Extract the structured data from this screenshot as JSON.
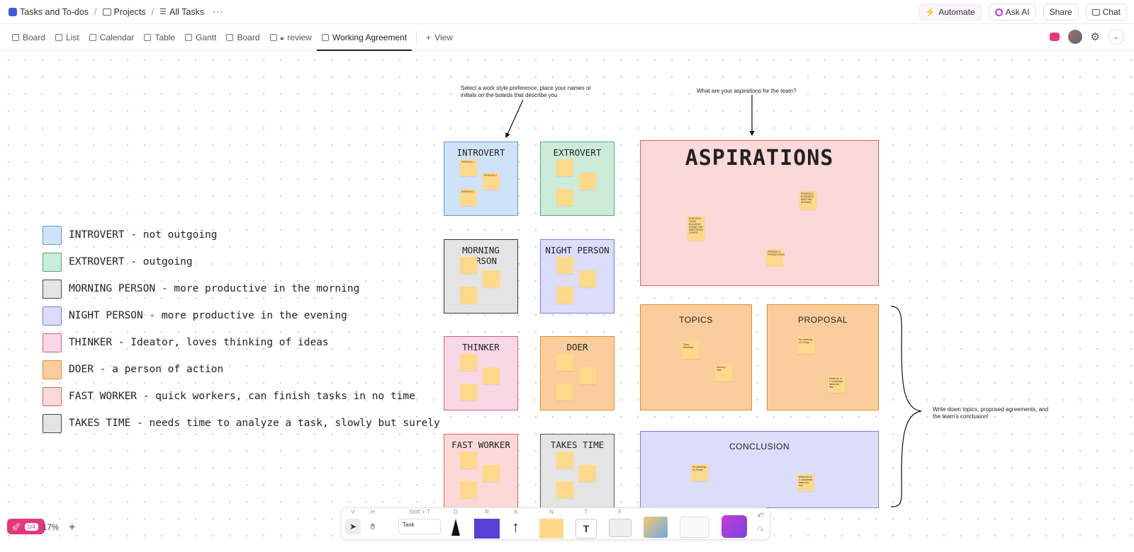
{
  "breadcrumb": {
    "workspace": "Tasks and To-dos",
    "projects": "Projects",
    "list": "All Tasks",
    "more": "···"
  },
  "top_actions": {
    "automate": "Automate",
    "ask_ai": "Ask AI",
    "share": "Share",
    "chat": "Chat"
  },
  "views": {
    "tabs": [
      "Board",
      "List",
      "Calendar",
      "Table",
      "Gantt",
      "Board",
      "review",
      "Working Agreement"
    ],
    "active": "Working Agreement",
    "add_view": "View"
  },
  "legend": [
    {
      "text": "INTROVERT - not outgoing",
      "color": "#cfe3f8"
    },
    {
      "text": "EXTROVERT - outgoing",
      "color": "#cdebd9"
    },
    {
      "text": "MORNING PERSON - more productive in the morning",
      "color": "#e4e4e4"
    },
    {
      "text": "NIGHT PERSON - more productive in the evening",
      "color": "#dcdcfb"
    },
    {
      "text": "THINKER - Ideator, loves thinking of ideas",
      "color": "#f8d8e5"
    },
    {
      "text": "DOER - a person of action",
      "color": "#fbcd9d"
    },
    {
      "text": "FAST WORKER - quick workers, can finish tasks in no time",
      "color": "#fbd9d9"
    },
    {
      "text": "TAKES TIME - needs time to analyze a task, slowly but surely",
      "color": "#e4e4e4"
    }
  ],
  "boards": {
    "introvert": {
      "title": "INTROVERT",
      "bg": "#cfe3f8",
      "border": "#5a9ce0",
      "stickies": [
        "PERSON 1",
        "PERSON 2",
        "PERSON 3"
      ]
    },
    "extrovert": {
      "title": "EXTROVERT",
      "bg": "#cdebd9",
      "border": "#4caf75"
    },
    "morning": {
      "title": "MORNING PERSON",
      "bg": "#e4e4e4",
      "border": "#333333"
    },
    "night": {
      "title": "NIGHT PERSON",
      "bg": "#dcdcfb",
      "border": "#7c7ce0"
    },
    "thinker": {
      "title": "THINKER",
      "bg": "#f8d8e5",
      "border": "#d75a8e"
    },
    "doer": {
      "title": "DOER",
      "bg": "#fbcd9d",
      "border": "#e58a2c"
    },
    "fast": {
      "title": "FAST WORKER",
      "bg": "#fbd9d9",
      "border": "#e06060"
    },
    "takes": {
      "title": "TAKES TIME",
      "bg": "#e4e4e4",
      "border": "#555555"
    }
  },
  "aspirations": {
    "title": "ASPIRATIONS",
    "stickies": [
      {
        "label": "PERSON 1",
        "text": "TEAM BUILDING INSIDE THE NORTHERN LIGHTS"
      },
      {
        "label": "PERSON 2",
        "text": "BUSINESS MEETING IN PARIS"
      },
      {
        "label": "PERSON 3",
        "text": "PROMOTIONS"
      }
    ]
  },
  "topics": {
    "title": "TOPICS",
    "stickies": [
      "Team Meetings",
      "Delivery date"
    ]
  },
  "proposal": {
    "title": "PROPOSAL",
    "stickies": [
      "No meetings on Friday",
      "Minimum of 2 completed tasks per day"
    ]
  },
  "conclusion": {
    "title": "CONCLUSION",
    "stickies": [
      "No meetings on Friday",
      "Minimum of 2 completed tasks per day"
    ]
  },
  "notes": {
    "work_style": "Select a work style preference, place your names or initials on the boards that describe you",
    "aspirations": "What are your aspirations for the team?",
    "agreements": "Write down topics, proposed agreements, and the team's conclusion!"
  },
  "bottom": {
    "launch_count": "0/4",
    "zoom": "17%",
    "tool_keys": [
      "V",
      "H",
      "Shift + T",
      "D",
      "R",
      "A",
      "N",
      "T",
      "F"
    ],
    "task_label": "Task"
  }
}
